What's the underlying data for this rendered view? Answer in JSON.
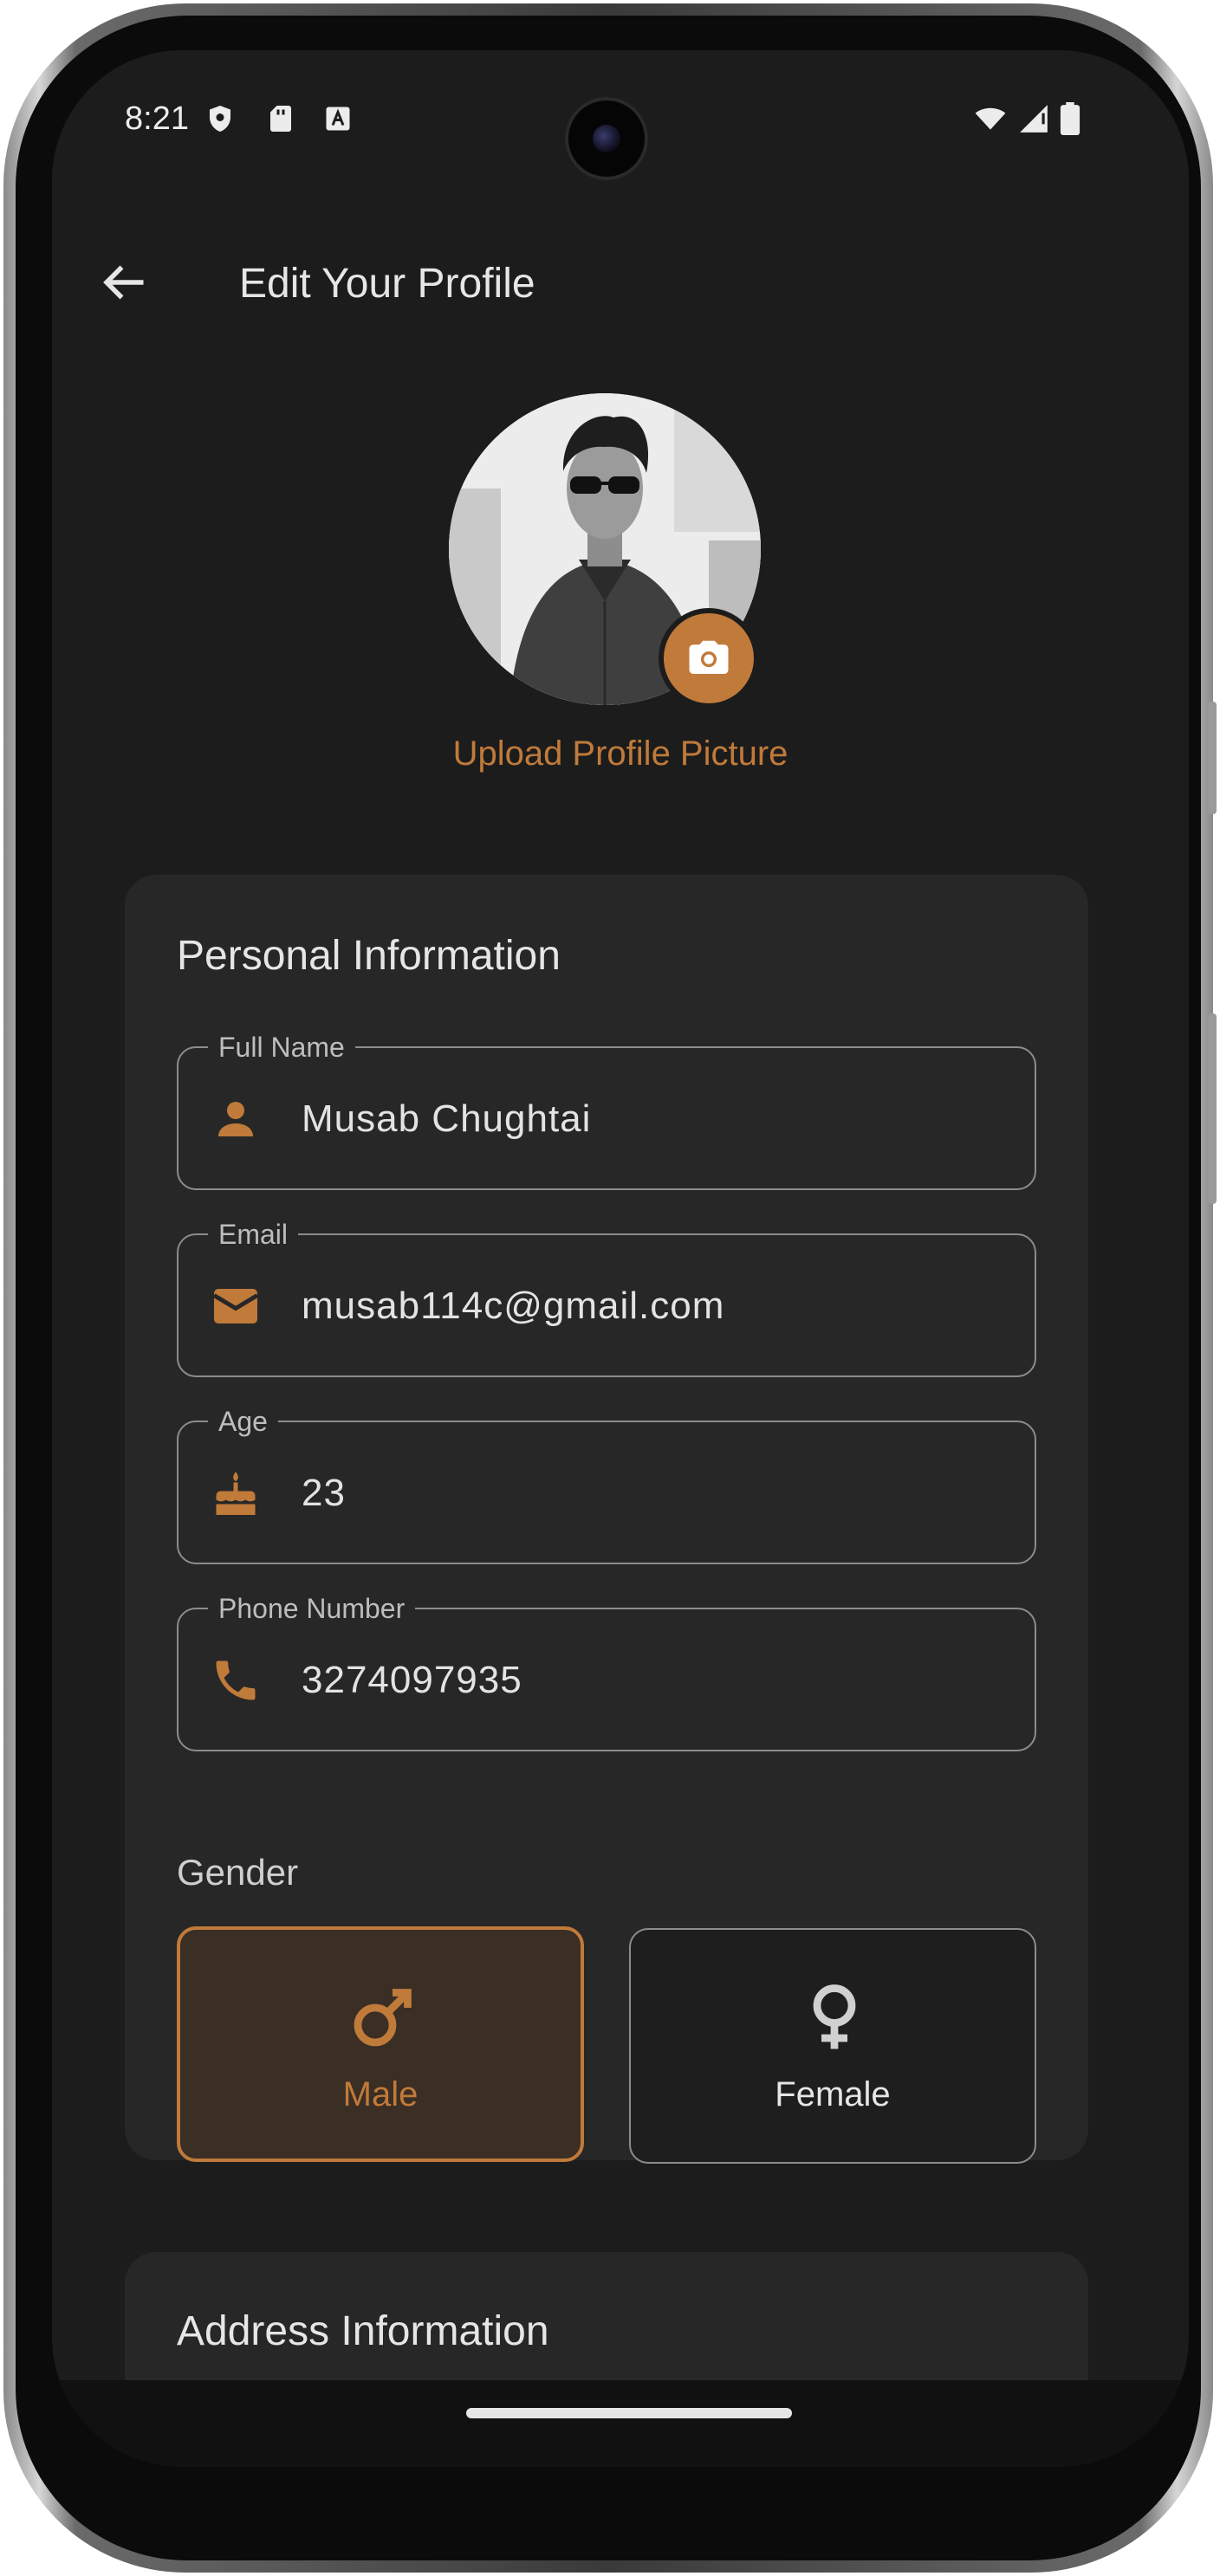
{
  "status_bar": {
    "time": "8:21",
    "left_icons": [
      "shield-icon",
      "sd-card-icon",
      "font-a-icon"
    ],
    "right_icons": [
      "wifi-icon",
      "signal-icon",
      "battery-icon"
    ]
  },
  "app_bar": {
    "back_icon": "arrow-back-icon",
    "title": "Edit Your Profile"
  },
  "profile": {
    "camera_icon": "camera-icon",
    "upload_label": "Upload Profile Picture"
  },
  "personal": {
    "title": "Personal Information",
    "fields": [
      {
        "label": "Full Name",
        "value": "Musab Chughtai",
        "icon": "person-icon"
      },
      {
        "label": "Email",
        "value": "musab114c@gmail.com",
        "icon": "email-icon"
      },
      {
        "label": "Age",
        "value": "23",
        "icon": "cake-icon"
      },
      {
        "label": "Phone Number",
        "value": "3274097935",
        "icon": "phone-icon"
      }
    ],
    "gender": {
      "label": "Gender",
      "options": [
        {
          "label": "Male",
          "icon": "male-icon",
          "selected": true
        },
        {
          "label": "Female",
          "icon": "female-icon",
          "selected": false
        }
      ]
    }
  },
  "address": {
    "title": "Address Information"
  },
  "colors": {
    "accent": "#c07a3a",
    "background": "#1c1c1c",
    "card": "#272727",
    "text": "#e6e6e6"
  }
}
